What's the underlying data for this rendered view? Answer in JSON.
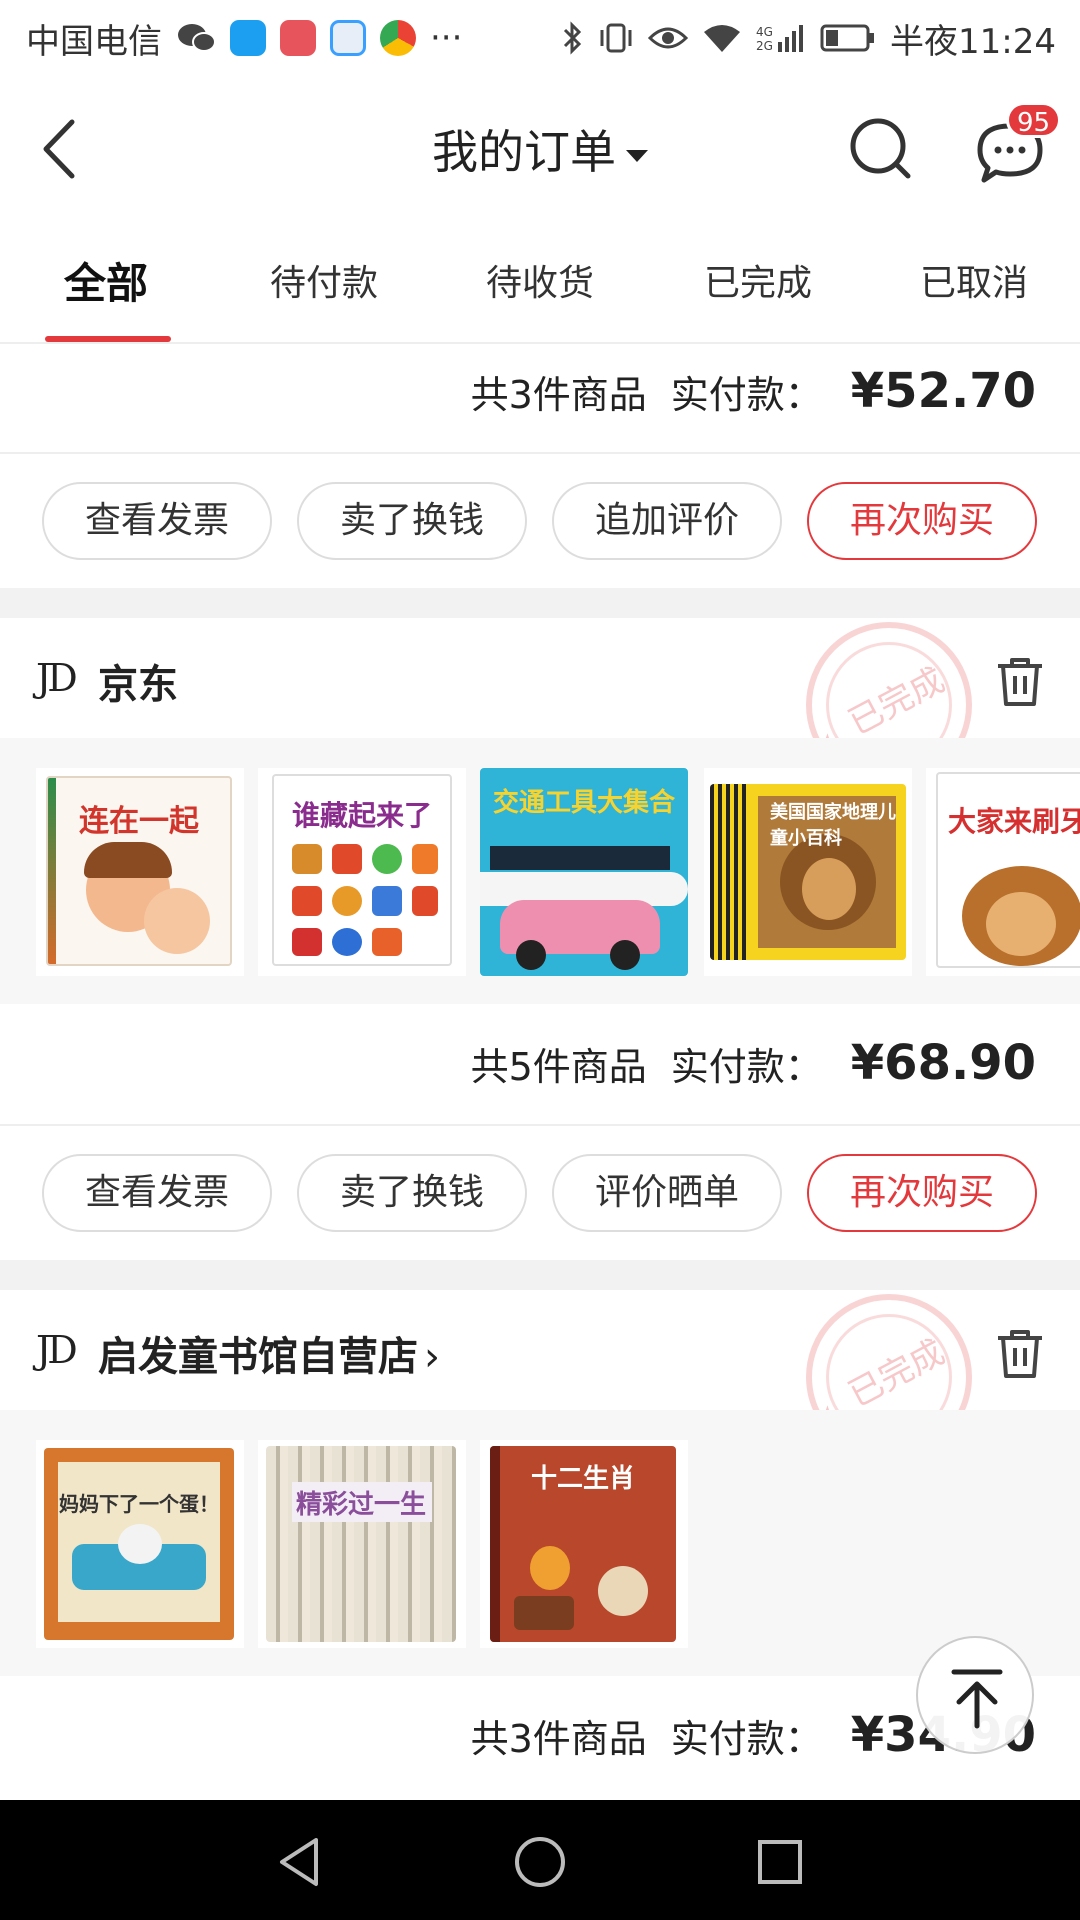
{
  "status_bar": {
    "carrier": "中国电信",
    "more": "···",
    "time_label": "半夜11:24",
    "network": "4G"
  },
  "header": {
    "title": "我的订单",
    "message_badge": "95"
  },
  "tabs": [
    "全部",
    "待付款",
    "待收货",
    "已完成",
    "已取消"
  ],
  "orders": [
    {
      "summary_count": "共3件商品",
      "summary_label": "实付款：",
      "summary_price": "¥52.70",
      "actions": [
        "查看发票",
        "卖了换钱",
        "追加评价",
        "再次购买"
      ]
    },
    {
      "shop_logo": "JD",
      "shop_name": "京东",
      "stamp": "已完成",
      "products": [
        "连在一起",
        "谁藏起来了",
        "交通工具大集合",
        "美国国家地理儿童小百科",
        "大家来刷牙"
      ],
      "summary_count": "共5件商品",
      "summary_label": "实付款：",
      "summary_price": "¥68.90",
      "actions": [
        "查看发票",
        "卖了换钱",
        "评价晒单",
        "再次购买"
      ]
    },
    {
      "shop_logo": "JD",
      "shop_name": "启发童书馆自营店",
      "stamp": "已完成",
      "products": [
        "妈妈下了一个蛋！",
        "精彩过一生",
        "十二生肖"
      ],
      "summary_count": "共3件商品",
      "summary_label": "实付款：",
      "summary_price": "¥34.90"
    }
  ],
  "colors": {
    "accent": "#e4393c",
    "divider": "#f2f2f2",
    "navbar": "#000000"
  }
}
